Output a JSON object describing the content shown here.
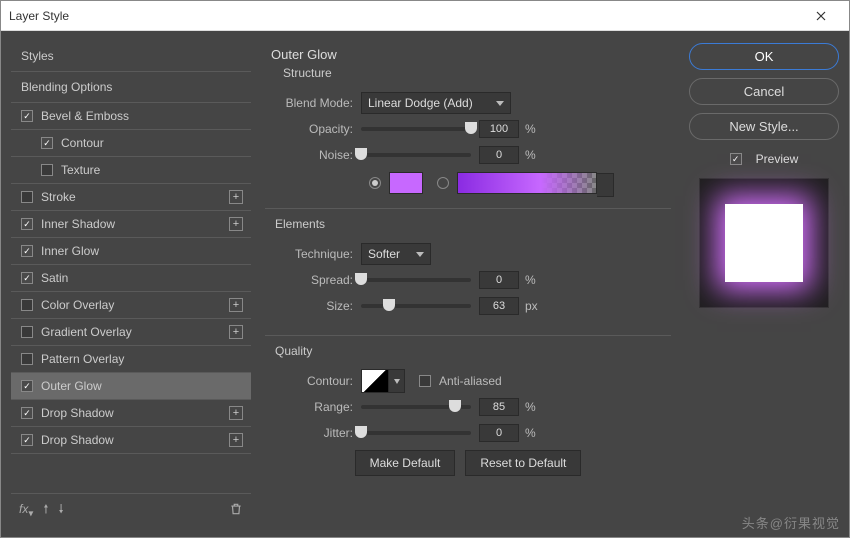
{
  "window": {
    "title": "Layer Style"
  },
  "sidebar": {
    "header": "Styles",
    "blending": "Blending Options",
    "items": [
      {
        "label": "Bevel & Emboss",
        "checked": true
      },
      {
        "label": "Contour",
        "checked": true,
        "indent": true
      },
      {
        "label": "Texture",
        "checked": false,
        "indent": true
      },
      {
        "label": "Stroke",
        "checked": false,
        "plus": true
      },
      {
        "label": "Inner Shadow",
        "checked": true,
        "plus": true
      },
      {
        "label": "Inner Glow",
        "checked": true
      },
      {
        "label": "Satin",
        "checked": true
      },
      {
        "label": "Color Overlay",
        "checked": false,
        "plus": true
      },
      {
        "label": "Gradient Overlay",
        "checked": false,
        "plus": true
      },
      {
        "label": "Pattern Overlay",
        "checked": false
      },
      {
        "label": "Outer Glow",
        "checked": true,
        "selected": true
      },
      {
        "label": "Drop Shadow",
        "checked": true,
        "plus": true
      },
      {
        "label": "Drop Shadow",
        "checked": true,
        "plus": true
      }
    ],
    "fx_label": "fx"
  },
  "panel": {
    "title": "Outer Glow",
    "structure": {
      "title": "Structure",
      "blend_mode_label": "Blend Mode:",
      "blend_mode_value": "Linear Dodge (Add)",
      "opacity_label": "Opacity:",
      "opacity_value": "100",
      "noise_label": "Noise:",
      "noise_value": "0",
      "pct": "%",
      "color": "#c768ff"
    },
    "elements": {
      "title": "Elements",
      "technique_label": "Technique:",
      "technique_value": "Softer",
      "spread_label": "Spread:",
      "spread_value": "0",
      "size_label": "Size:",
      "size_value": "63",
      "pct": "%",
      "px": "px"
    },
    "quality": {
      "title": "Quality",
      "contour_label": "Contour:",
      "antialiased_label": "Anti-aliased",
      "range_label": "Range:",
      "range_value": "85",
      "jitter_label": "Jitter:",
      "jitter_value": "0",
      "pct": "%"
    },
    "make_default": "Make Default",
    "reset_default": "Reset to Default"
  },
  "right": {
    "ok": "OK",
    "cancel": "Cancel",
    "new_style": "New Style...",
    "preview": "Preview"
  },
  "watermark": "头条@衍果视觉"
}
